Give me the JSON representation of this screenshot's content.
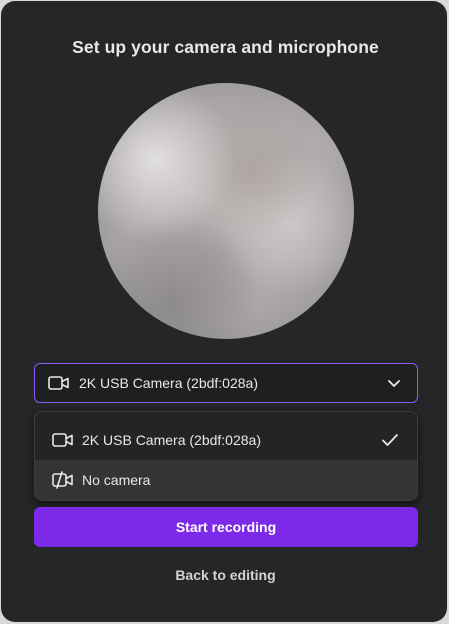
{
  "dialog": {
    "title": "Set up your camera and microphone"
  },
  "camera_select": {
    "selected_label": "2K USB Camera (2bdf:028a)",
    "icon": "video-camera-icon",
    "accent_color": "#8b5cf6"
  },
  "camera_menu": {
    "items": [
      {
        "label": "2K USB Camera (2bdf:028a)",
        "icon": "video-camera-icon",
        "selected": true
      },
      {
        "label": "No camera",
        "icon": "video-camera-off-icon",
        "selected": false
      }
    ]
  },
  "actions": {
    "start_label": "Start recording",
    "start_color": "#7d2ae8",
    "back_label": "Back to editing"
  }
}
